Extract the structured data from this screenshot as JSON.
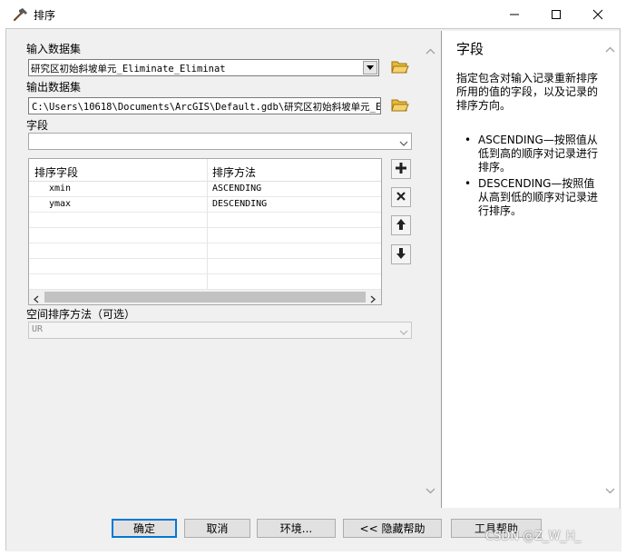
{
  "window": {
    "title": "排序",
    "minimize_icon": "minimize-icon",
    "maximize_icon": "maximize-icon",
    "close_icon": "close-icon"
  },
  "form": {
    "input_label": "输入数据集",
    "input_value": "研究区初始斜坡单元_Eliminate_Eliminat",
    "output_label": "输出数据集",
    "output_value": "C:\\Users\\10618\\Documents\\ArcGIS\\Default.gdb\\研究区初始斜坡单元_E",
    "field_label": "字段",
    "field_value": "",
    "sort_table": {
      "columns": [
        "排序字段",
        "排序方法"
      ],
      "rows": [
        {
          "field": "xmin",
          "method": "ASCENDING"
        },
        {
          "field": "ymax",
          "method": "DESCENDING"
        }
      ]
    },
    "spatial_label": "空间排序方法（可选）",
    "spatial_value": "UR"
  },
  "help": {
    "title": "字段",
    "description": "指定包含对输入记录重新排序所用的值的字段，以及记录的排序方向。",
    "items": [
      "ASCENDING—按照值从低到高的顺序对记录进行排序。",
      "DESCENDING—按照值从高到低的顺序对记录进行排序。"
    ]
  },
  "buttons": {
    "ok": "确定",
    "cancel": "取消",
    "environments": "环境...",
    "hide_help": "<< 隐藏帮助",
    "tool_help": "工具帮助"
  },
  "watermark": "CSDN @Z_W_H_",
  "colors": {
    "default_button_border": "#0078d7",
    "panel_bg": "#f0f0f0",
    "add_icon": "#222222"
  },
  "icons": {
    "title": "hammer-icon",
    "browse": "open-folder-icon",
    "add": "plus-icon",
    "remove": "x-icon",
    "up": "arrow-up-icon",
    "down": "arrow-down-icon"
  }
}
